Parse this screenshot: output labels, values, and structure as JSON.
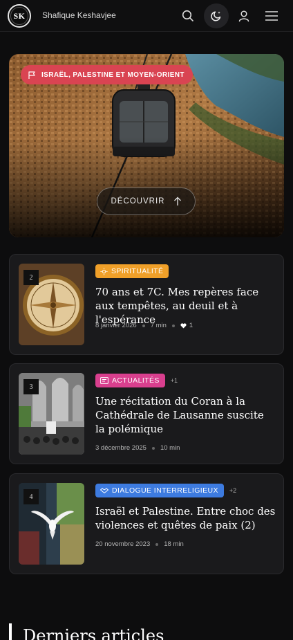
{
  "header": {
    "logo_text": "SK",
    "site_name": "Shafique Keshavjee",
    "icons": [
      "search-icon",
      "theme-toggle-icon",
      "user-icon",
      "menu-icon"
    ]
  },
  "hero": {
    "category": "ISRAËL, PALESTINE ET MOYEN-ORIENT",
    "category_color": "#d94452",
    "button_label": "DÉCOUVRIR"
  },
  "articles": [
    {
      "rank": "2",
      "category": "SPIRITUALITÉ",
      "category_color": "#f0a029",
      "category_icon": "sun-icon",
      "extra_tags": "",
      "title": "70 ans et 7C. Mes repères face aux tempêtes, au deuil et à l'espérance",
      "date": "8 janvier 2026",
      "read_time": "7 min",
      "likes": "1"
    },
    {
      "rank": "3",
      "category": "ACTUALITÉS",
      "category_color": "#d93f8e",
      "category_icon": "newspaper-icon",
      "extra_tags": "+1",
      "title": "Une récitation du Coran à la Cathédrale de Lausanne suscite la polémique",
      "date": "3 décembre 2025",
      "read_time": "10 min"
    },
    {
      "rank": "4",
      "category": "DIALOGUE INTERRELIGIEUX",
      "category_color": "#3d7be0",
      "category_icon": "handshake-icon",
      "extra_tags": "+2",
      "title": "Israël et Palestine. Entre choc des violences et quêtes de paix (2)",
      "date": "20 novembre 2023",
      "read_time": "18 min"
    }
  ],
  "section": {
    "title": "Derniers articles"
  }
}
